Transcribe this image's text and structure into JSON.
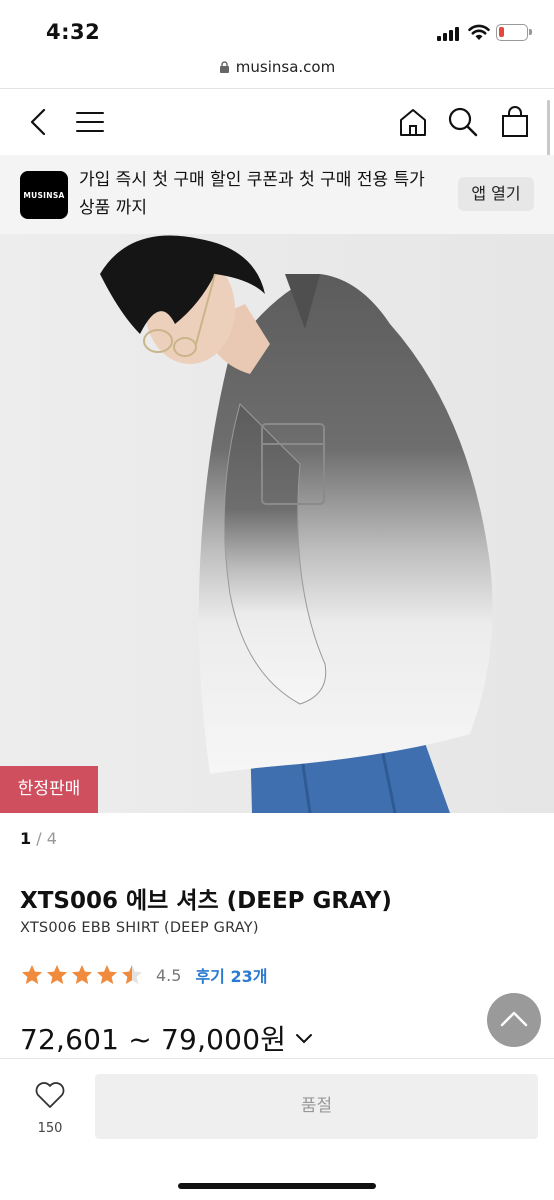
{
  "status_bar": {
    "time": "4:32",
    "battery_color": "#e5483b"
  },
  "browser": {
    "url": "musinsa.com"
  },
  "nav": {
    "icons": [
      "back-icon",
      "menu-icon",
      "home-icon",
      "search-icon",
      "shopping-bag-icon"
    ]
  },
  "app_banner": {
    "logo_text": "MUSINSA",
    "message_line1": "가입 즉시 첫 구매 할인 쿠폰과 첫 구매 전용 특가",
    "message_line2": "상품 까지",
    "open_label": "앱 열기"
  },
  "product": {
    "badge": "한정판매",
    "badge_color": "#cf4f5f",
    "image_index": "1",
    "image_sep": " / ",
    "image_total": "4",
    "title": "XTS006 에브 셔츠 (DEEP GRAY)",
    "subtitle": "XTS006 EBB SHIRT (DEEP GRAY)",
    "rating": 4.5,
    "rating_text": "4.5",
    "star_color": "#f08a3d",
    "reviews_label": "후기 23개",
    "reviews_color": "#2a7bd1",
    "price_range": "72,601 ~ 79,000원"
  },
  "bottom_bar": {
    "like_count": "150",
    "soldout_label": "품절"
  }
}
